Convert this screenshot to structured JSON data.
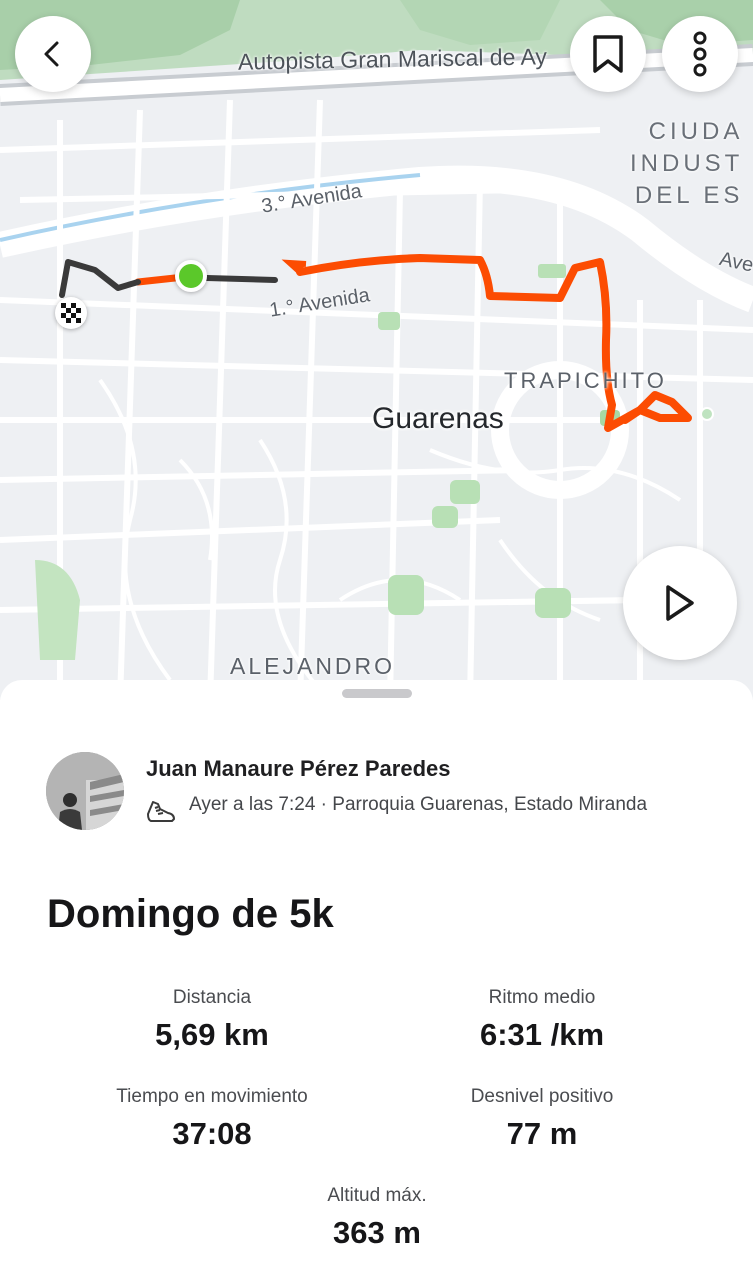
{
  "map": {
    "labels": {
      "autopista": "Autopista Gran Mariscal de Ay",
      "tercera_avenida": "3.° Avenida",
      "primera_avenida": "1.° Avenida",
      "ave_right": "Ave",
      "ciudad_line1": "CIUDA",
      "ciudad_line2": "INDUST",
      "ciudad_line3": "DEL ES",
      "trapichito": "TRAPICHITO",
      "guarenas": "Guarenas",
      "alejandro": "ALEJANDRO"
    },
    "route_colors": {
      "main": "#fc4c02",
      "overlap": "#3a3a3a",
      "start": "#5bc82a"
    }
  },
  "buttons": {
    "back_icon": "chevron-left-icon",
    "bookmark_icon": "bookmark-icon",
    "more_icon": "more-vertical-icon",
    "play_icon": "play-icon"
  },
  "athlete": {
    "name": "Juan Manaure Pérez Paredes",
    "meta": "Ayer a las 7:24 · Parroquia Guarenas, Estado Miranda",
    "activity_icon": "shoe-icon"
  },
  "activity": {
    "title": "Domingo de 5k"
  },
  "stats": {
    "distance": {
      "label": "Distancia",
      "value": "5,69 km"
    },
    "pace": {
      "label": "Ritmo medio",
      "value": "6:31 /km"
    },
    "moving_time": {
      "label": "Tiempo en movimiento",
      "value": "37:08"
    },
    "elevation_gain": {
      "label": "Desnivel positivo",
      "value": "77 m"
    },
    "max_altitude": {
      "label": "Altitud máx.",
      "value": "363 m"
    }
  }
}
